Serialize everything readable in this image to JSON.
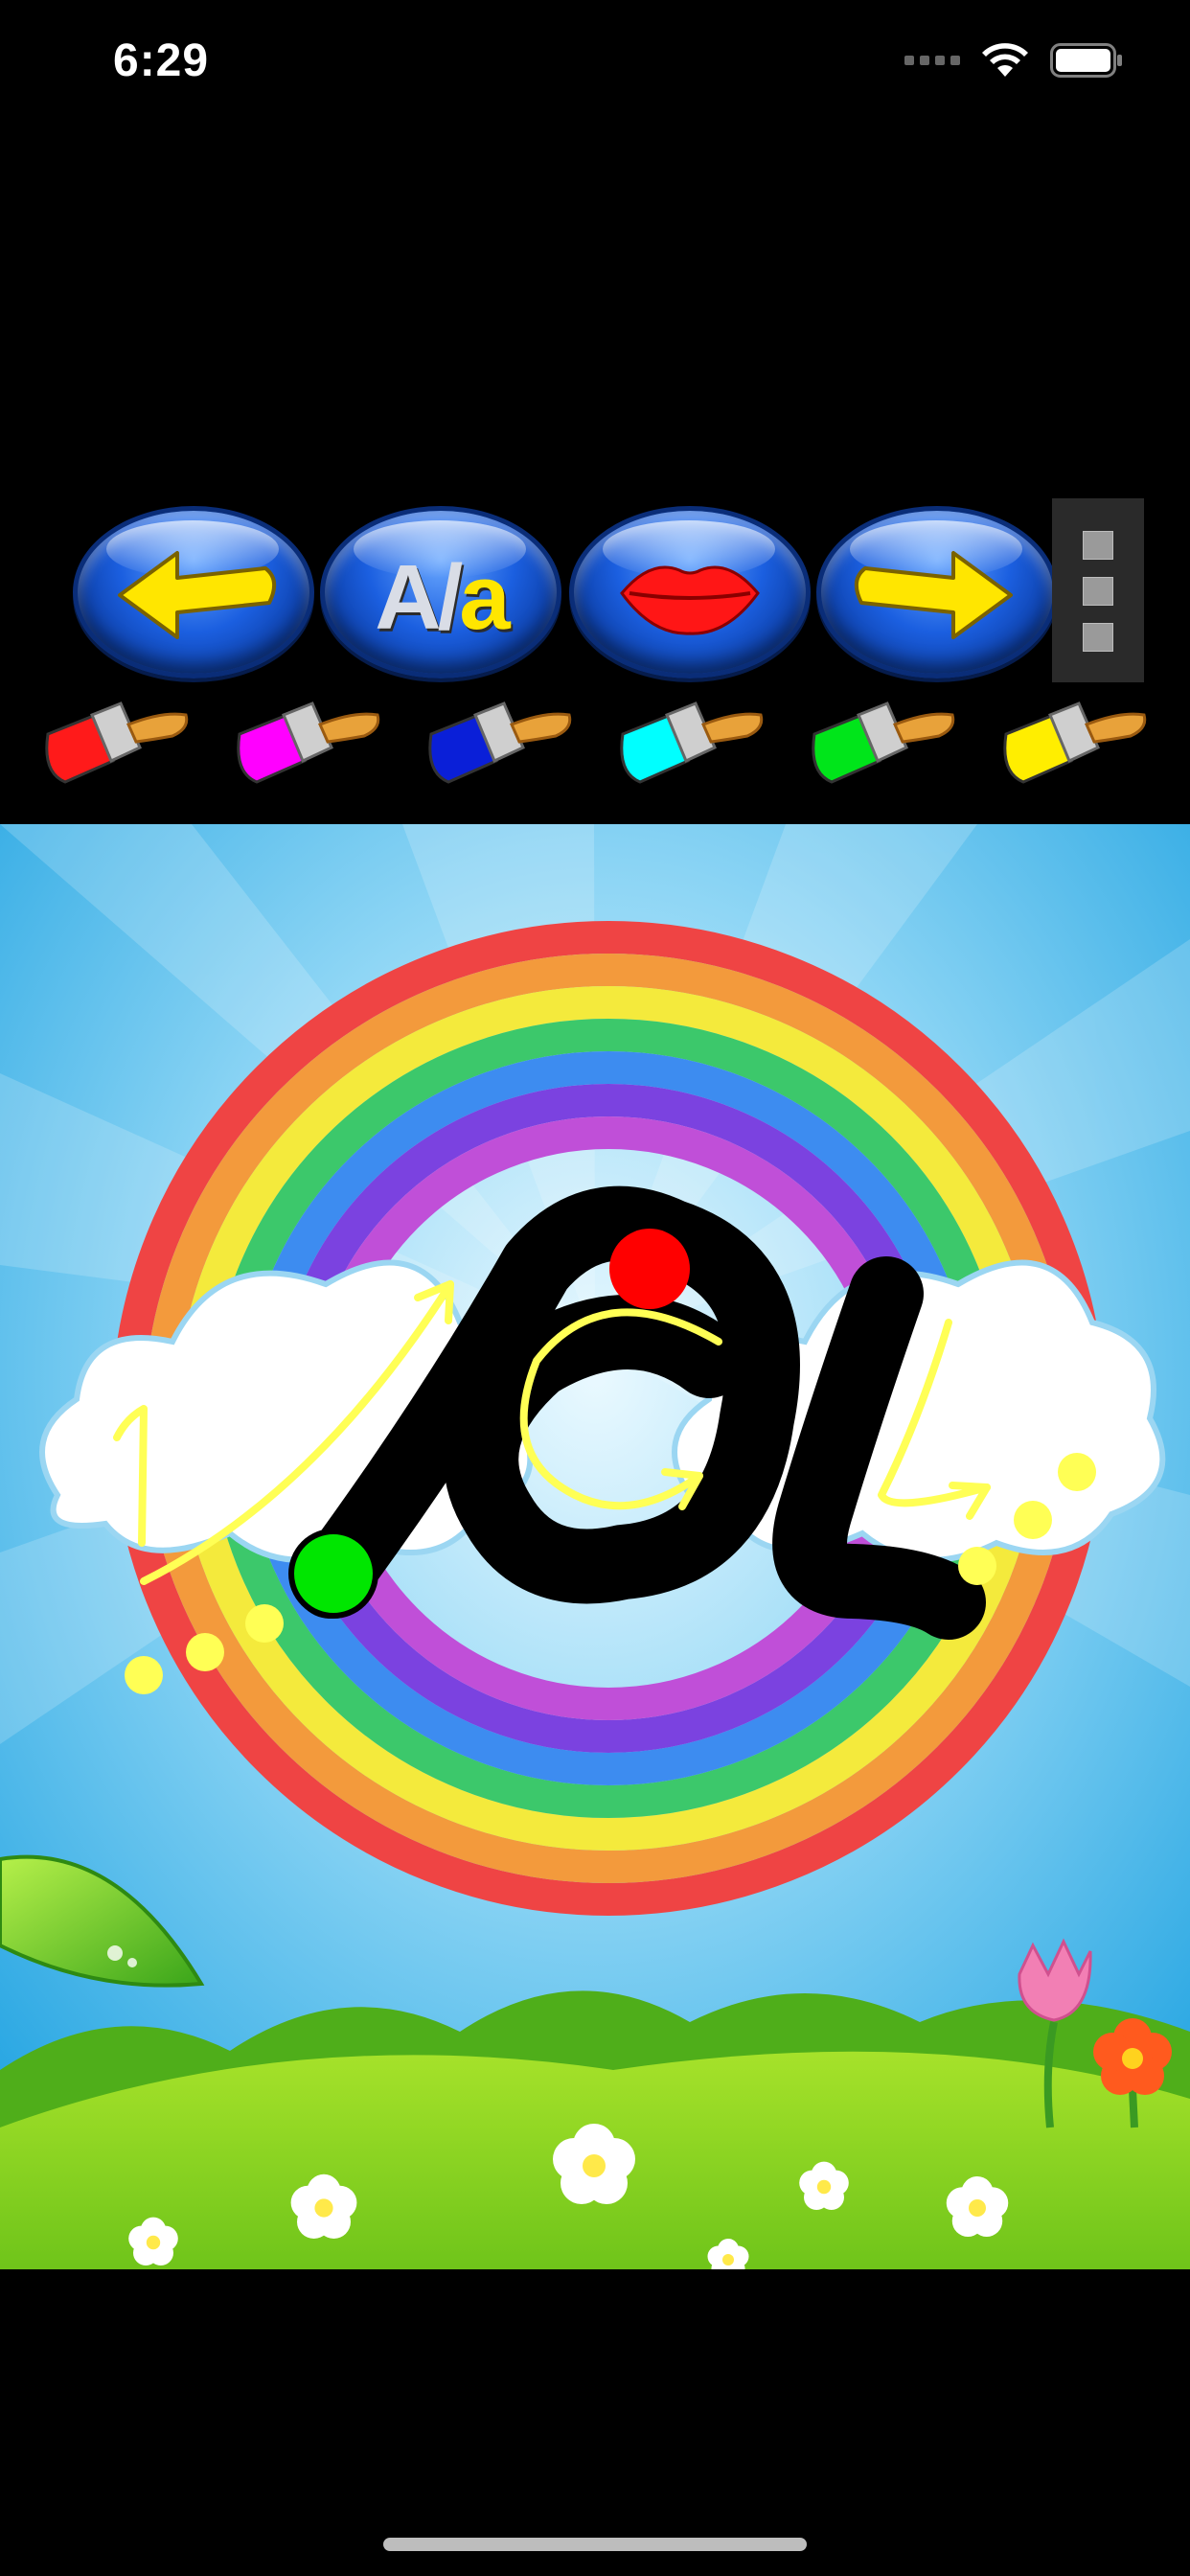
{
  "status_bar": {
    "time": "6:29"
  },
  "toolbar": {
    "buttons": [
      {
        "name": "previous-letter",
        "icon": "arrow-left-icon"
      },
      {
        "name": "toggle-case",
        "upper": "A",
        "slash": "/",
        "lower": "a"
      },
      {
        "name": "speak-letter",
        "icon": "lips-icon"
      },
      {
        "name": "next-letter",
        "icon": "arrow-right-icon"
      }
    ],
    "menu_icon": "more-vertical-icon",
    "brush_colors": [
      "#ff1a1a",
      "#ff00ff",
      "#0a1fd8",
      "#00ffff",
      "#00e51a",
      "#ffee00"
    ]
  },
  "canvas": {
    "current_letter": "a",
    "start_dot_color": "#00e600",
    "end_dot_color": "#ff0000",
    "guide_color": "#ffff55",
    "stroke_color": "#000000",
    "guide_numbers": [
      "1"
    ]
  }
}
